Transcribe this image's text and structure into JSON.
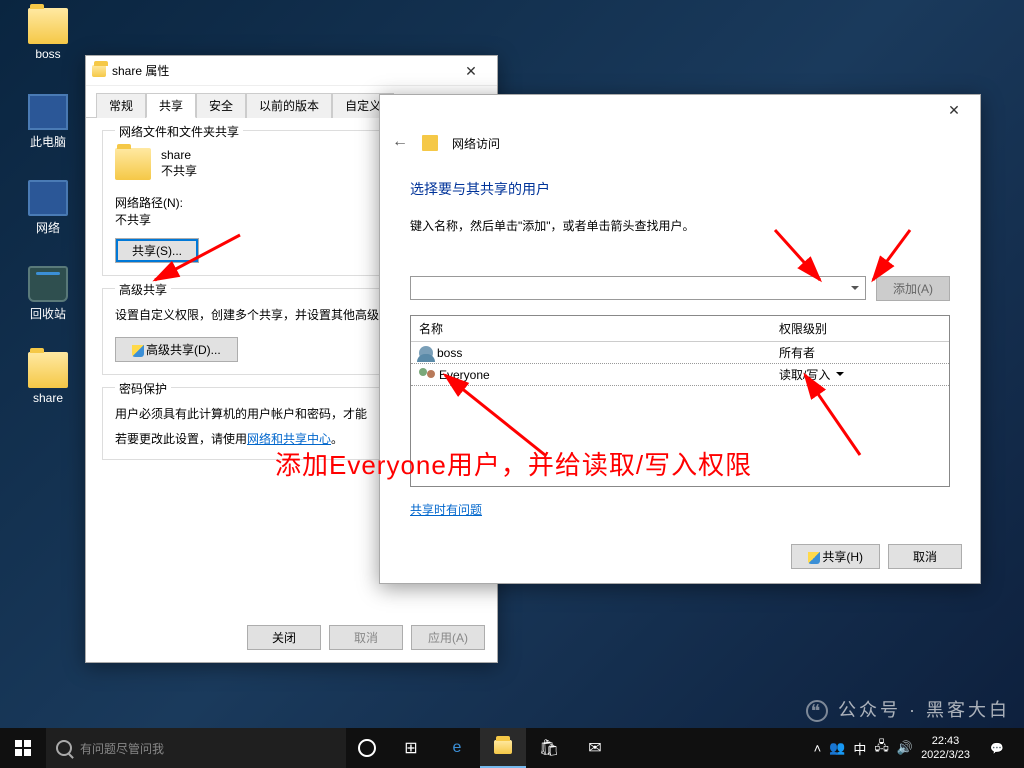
{
  "desktop": {
    "icons": [
      "boss",
      "此电脑",
      "网络",
      "回收站",
      "share"
    ]
  },
  "props_window": {
    "title": "share 属性",
    "tabs": [
      "常规",
      "共享",
      "安全",
      "以前的版本",
      "自定义"
    ],
    "active_tab": 1,
    "section1": {
      "title": "网络文件和文件夹共享",
      "share_name": "share",
      "share_status": "不共享",
      "path_label": "网络路径(N):",
      "path_value": "不共享",
      "share_btn": "共享(S)..."
    },
    "section2": {
      "title": "高级共享",
      "desc": "设置自定义权限，创建多个共享，并设置其他高级",
      "adv_btn": "高级共享(D)..."
    },
    "section3": {
      "title": "密码保护",
      "desc1": "用户必须具有此计算机的用户帐户和密码，才能",
      "desc2_pre": "若要更改此设置，请使用",
      "desc2_link": "网络和共享中心",
      "desc2_post": "。"
    },
    "buttons": {
      "close": "关闭",
      "cancel": "取消",
      "apply": "应用(A)"
    }
  },
  "netacc_window": {
    "title": "网络访问",
    "heading": "选择要与其共享的用户",
    "desc": "键入名称，然后单击\"添加\"，或者单击箭头查找用户。",
    "add_btn": "添加(A)",
    "col_name": "名称",
    "col_perm": "权限级别",
    "rows": [
      {
        "name": "boss",
        "perm": "所有者",
        "type": "single"
      },
      {
        "name": "Everyone",
        "perm": "读取/写入",
        "type": "multi",
        "dropdown": true
      }
    ],
    "help_link": "共享时有问题",
    "share_btn": "共享(H)",
    "cancel_btn": "取消"
  },
  "annotation": "添加Everyone用户，并给读取/写入权限",
  "taskbar": {
    "search_placeholder": "有问题尽管问我",
    "time": "22:43",
    "date": "2022/3/23"
  },
  "watermark": "公众号 · 黑客大白"
}
